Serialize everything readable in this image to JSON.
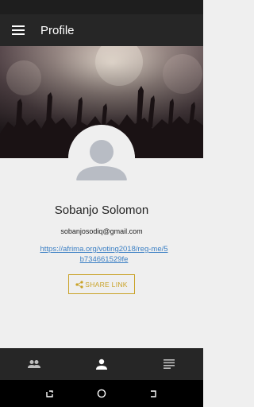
{
  "app_bar": {
    "title": "Profile",
    "menu_icon": "hamburger-menu-icon"
  },
  "profile": {
    "name": "Sobanjo Solomon",
    "email": "sobanjosodiq@gmail.com",
    "link": "https://afrima.org/voting2018/reg-me/5b734661529fe",
    "avatar_icon": "default-avatar-icon"
  },
  "share_button": {
    "label": "SHARE LINK",
    "icon": "share-icon"
  },
  "bottom_nav": [
    {
      "name": "people",
      "icon": "people-icon",
      "active": false
    },
    {
      "name": "profile",
      "icon": "person-icon",
      "active": true
    },
    {
      "name": "list",
      "icon": "list-icon",
      "active": false
    }
  ],
  "colors": {
    "app_bar": "#262626",
    "accent_gold": "#c9a227",
    "link_blue": "#3b7fc4",
    "background": "#efefef"
  }
}
